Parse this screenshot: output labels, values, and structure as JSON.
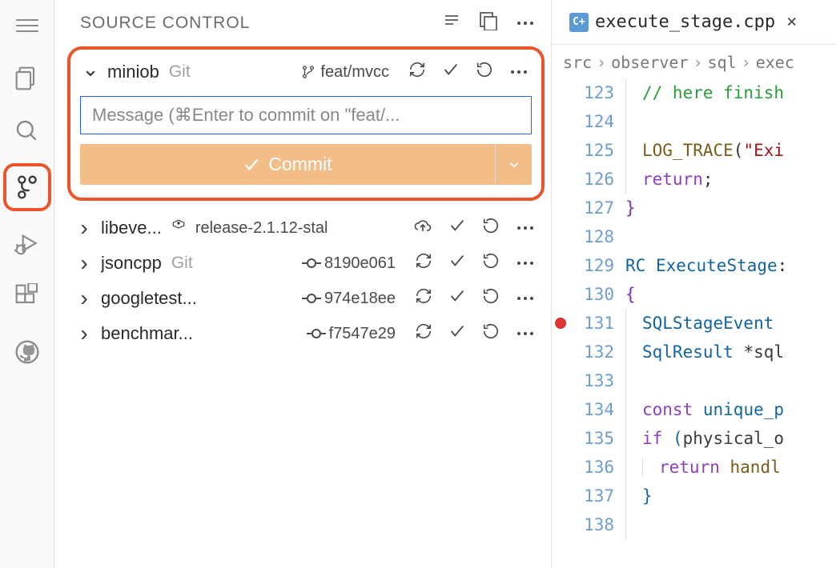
{
  "source_control": {
    "title": "SOURCE CONTROL",
    "miniob": {
      "name": "miniob",
      "type": "Git",
      "branch": "feat/mvcc",
      "commit_placeholder": "Message (⌘Enter to commit on \"feat/...",
      "commit_button": "Commit"
    },
    "repos": [
      {
        "name": "libeve...",
        "type_or_tag": "release-2.1.12-stal",
        "uses_tag_icon": true,
        "uses_cloud": true,
        "hash": ""
      },
      {
        "name": "jsoncpp",
        "type_or_tag": "Git",
        "uses_tag_icon": false,
        "uses_cloud": false,
        "hash": "8190e061"
      },
      {
        "name": "googletest...",
        "type_or_tag": "",
        "uses_tag_icon": false,
        "uses_cloud": false,
        "hash": "974e18ee"
      },
      {
        "name": "benchmar...",
        "type_or_tag": "",
        "uses_tag_icon": false,
        "uses_cloud": false,
        "hash": "f7547e29"
      }
    ]
  },
  "editor": {
    "tab_filename": "execute_stage.cpp",
    "cpp_badge": "C+",
    "breadcrumb": [
      "src",
      "observer",
      "sql",
      "exec"
    ],
    "lines": [
      {
        "num": "123",
        "bp": false,
        "html": "<span class='c-comment'>// here finish</span>"
      },
      {
        "num": "124",
        "bp": false,
        "html": ""
      },
      {
        "num": "125",
        "bp": false,
        "html": "<span class='c-func'>LOG_TRACE</span><span class='c-punct'>(</span><span class='c-str'>\"Exi</span>"
      },
      {
        "num": "126",
        "bp": false,
        "html": "<span class='c-keyword'>return</span><span class='c-punct'>;</span>"
      },
      {
        "num": "127",
        "bp": false,
        "html": "<span class='c-brace'>}</span>",
        "noindent": true
      },
      {
        "num": "128",
        "bp": false,
        "html": "",
        "noindent": true
      },
      {
        "num": "129",
        "bp": false,
        "html": "<span class='c-type'>RC</span> <span class='c-type'>ExecuteStage</span><span class='c-punct'>:</span>",
        "noindent": true
      },
      {
        "num": "130",
        "bp": false,
        "html": "<span class='c-brace'>{</span>",
        "noindent": true
      },
      {
        "num": "131",
        "bp": true,
        "html": "<span class='c-type'>SQLStageEvent</span> "
      },
      {
        "num": "132",
        "bp": false,
        "html": "<span class='c-type'>SqlResult</span> <span class='c-punct'>*</span>sql"
      },
      {
        "num": "133",
        "bp": false,
        "html": ""
      },
      {
        "num": "134",
        "bp": false,
        "html": "<span class='c-keyword'>const</span> <span class='c-type'>unique_p</span>"
      },
      {
        "num": "135",
        "bp": false,
        "html": "<span class='c-keyword'>if</span> <span class='c-brace2'>(</span>physical_o"
      },
      {
        "num": "136",
        "bp": false,
        "html": "<span class='indent-guide'></span><span class='c-keyword'>return</span> <span class='c-func'>handl</span>"
      },
      {
        "num": "137",
        "bp": false,
        "html": "<span class='c-brace2'>}</span>"
      },
      {
        "num": "138",
        "bp": false,
        "html": "",
        "half": true
      }
    ]
  }
}
